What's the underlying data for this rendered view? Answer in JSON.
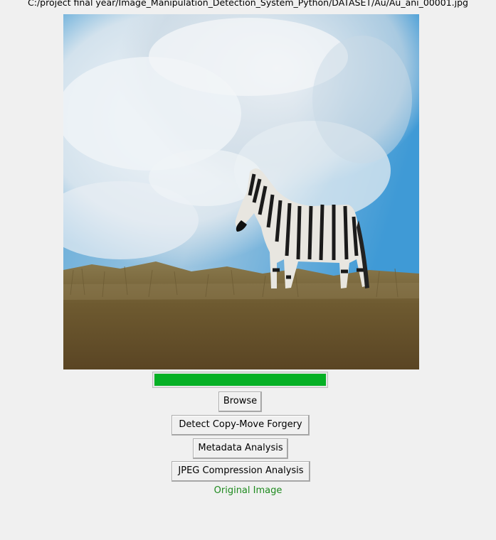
{
  "file_path": "C:/project final year/Image_Manipulation_Detection_System_Python/DATASET/Au/Au_ani_00001.jpg",
  "preview": {
    "description_icon": "zebra-photo"
  },
  "progress": {
    "value": 1.0,
    "color": "#06b025"
  },
  "buttons": {
    "browse": "Browse",
    "copy_move": "Detect Copy-Move Forgery",
    "metadata": "Metadata Analysis",
    "jpeg": "JPEG Compression Analysis"
  },
  "status": {
    "text": "Original Image",
    "color": "#1e8a1e"
  }
}
